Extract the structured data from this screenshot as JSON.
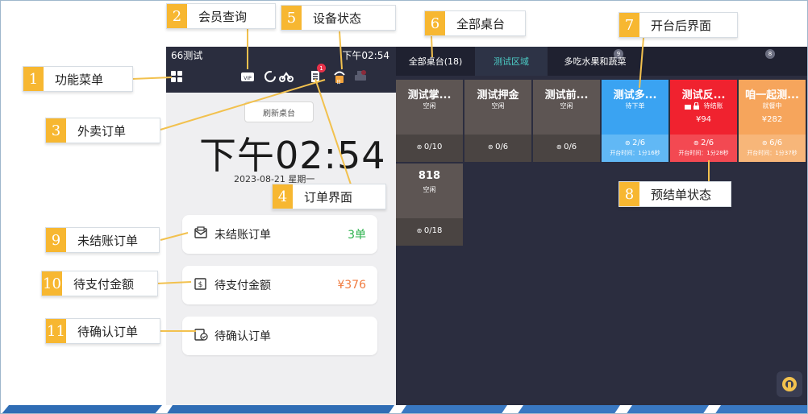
{
  "header": {
    "store_name": "66测试",
    "time_small": "下午02:54",
    "refresh_label": "刷新桌台",
    "time_large": "下午02:54",
    "date": "2023-08-21 星期一"
  },
  "icons": {
    "menu": "grid-icon",
    "vip": "vip-icon",
    "takeout": "takeout-icon",
    "order": "order-icon",
    "device": "device-icon",
    "printer": "printer-icon"
  },
  "badges": {
    "order_count": "1",
    "device_label": "日"
  },
  "stats": [
    {
      "label": "未结账订单",
      "value": "3单",
      "value_color": "#2bb24c"
    },
    {
      "label": "待支付金额",
      "value": "¥376",
      "value_color": "#f07b3f"
    },
    {
      "label": "待确认订单",
      "value": "",
      "value_color": "#333333"
    }
  ],
  "tabs": [
    {
      "label": "全部桌台(18)",
      "badge": ""
    },
    {
      "label": "测试区域",
      "badge": "9"
    },
    {
      "label": "多吃水果和蔬菜",
      "badge": "8"
    }
  ],
  "tables": [
    {
      "name": "测试掌...",
      "status": "空闲",
      "amount": "",
      "seats": "0/10",
      "open_time": "",
      "color": "#5d5553",
      "bottom_color": "#4a4442",
      "lock_icon": false
    },
    {
      "name": "测试押金",
      "status": "空闲",
      "amount": "",
      "seats": "0/6",
      "open_time": "",
      "color": "#5d5553",
      "bottom_color": "#4a4442",
      "lock_icon": false
    },
    {
      "name": "测试前...",
      "status": "空闲",
      "amount": "",
      "seats": "0/6",
      "open_time": "",
      "color": "#5d5553",
      "bottom_color": "#4a4442",
      "lock_icon": false
    },
    {
      "name": "测试多...",
      "status": "待下单",
      "amount": "",
      "seats": "2/6",
      "open_time": "开台时间：1分16秒",
      "color": "#3aa3f2",
      "bottom_color": "#61b8f5",
      "lock_icon": false
    },
    {
      "name": "测试反...",
      "status": "待结账",
      "amount": "¥94",
      "seats": "2/6",
      "open_time": "开台时间：1分28秒",
      "color": "#f0222f",
      "bottom_color": "#f34952",
      "lock_icon": true
    },
    {
      "name": "咱一起测...",
      "status": "就餐中",
      "amount": "¥282",
      "seats": "6/6",
      "open_time": "开台时间：1分37秒",
      "color": "#f6a55c",
      "bottom_color": "#f7b679",
      "lock_icon": false
    },
    {
      "name": "818",
      "status": "空闲",
      "amount": "",
      "seats": "0/18",
      "open_time": "",
      "color": "#5d5553",
      "bottom_color": "#4a4442",
      "lock_icon": false
    }
  ],
  "callouts": [
    {
      "num": "1",
      "text": "功能菜单"
    },
    {
      "num": "2",
      "text": "会员查询"
    },
    {
      "num": "3",
      "text": "外卖订单"
    },
    {
      "num": "4",
      "text": "订单界面"
    },
    {
      "num": "5",
      "text": "设备状态"
    },
    {
      "num": "6",
      "text": "全部桌台"
    },
    {
      "num": "7",
      "text": "开台后界面"
    },
    {
      "num": "8",
      "text": "预结单状态"
    },
    {
      "num": "9",
      "text": "未结账订单"
    },
    {
      "num": "10",
      "text": "待支付金额"
    },
    {
      "num": "11",
      "text": "待确认订单"
    }
  ],
  "colors": {
    "accent_tab": "#4dd0c9",
    "callout_number_bg": "#f7b731",
    "connector": "#f2c14e"
  }
}
